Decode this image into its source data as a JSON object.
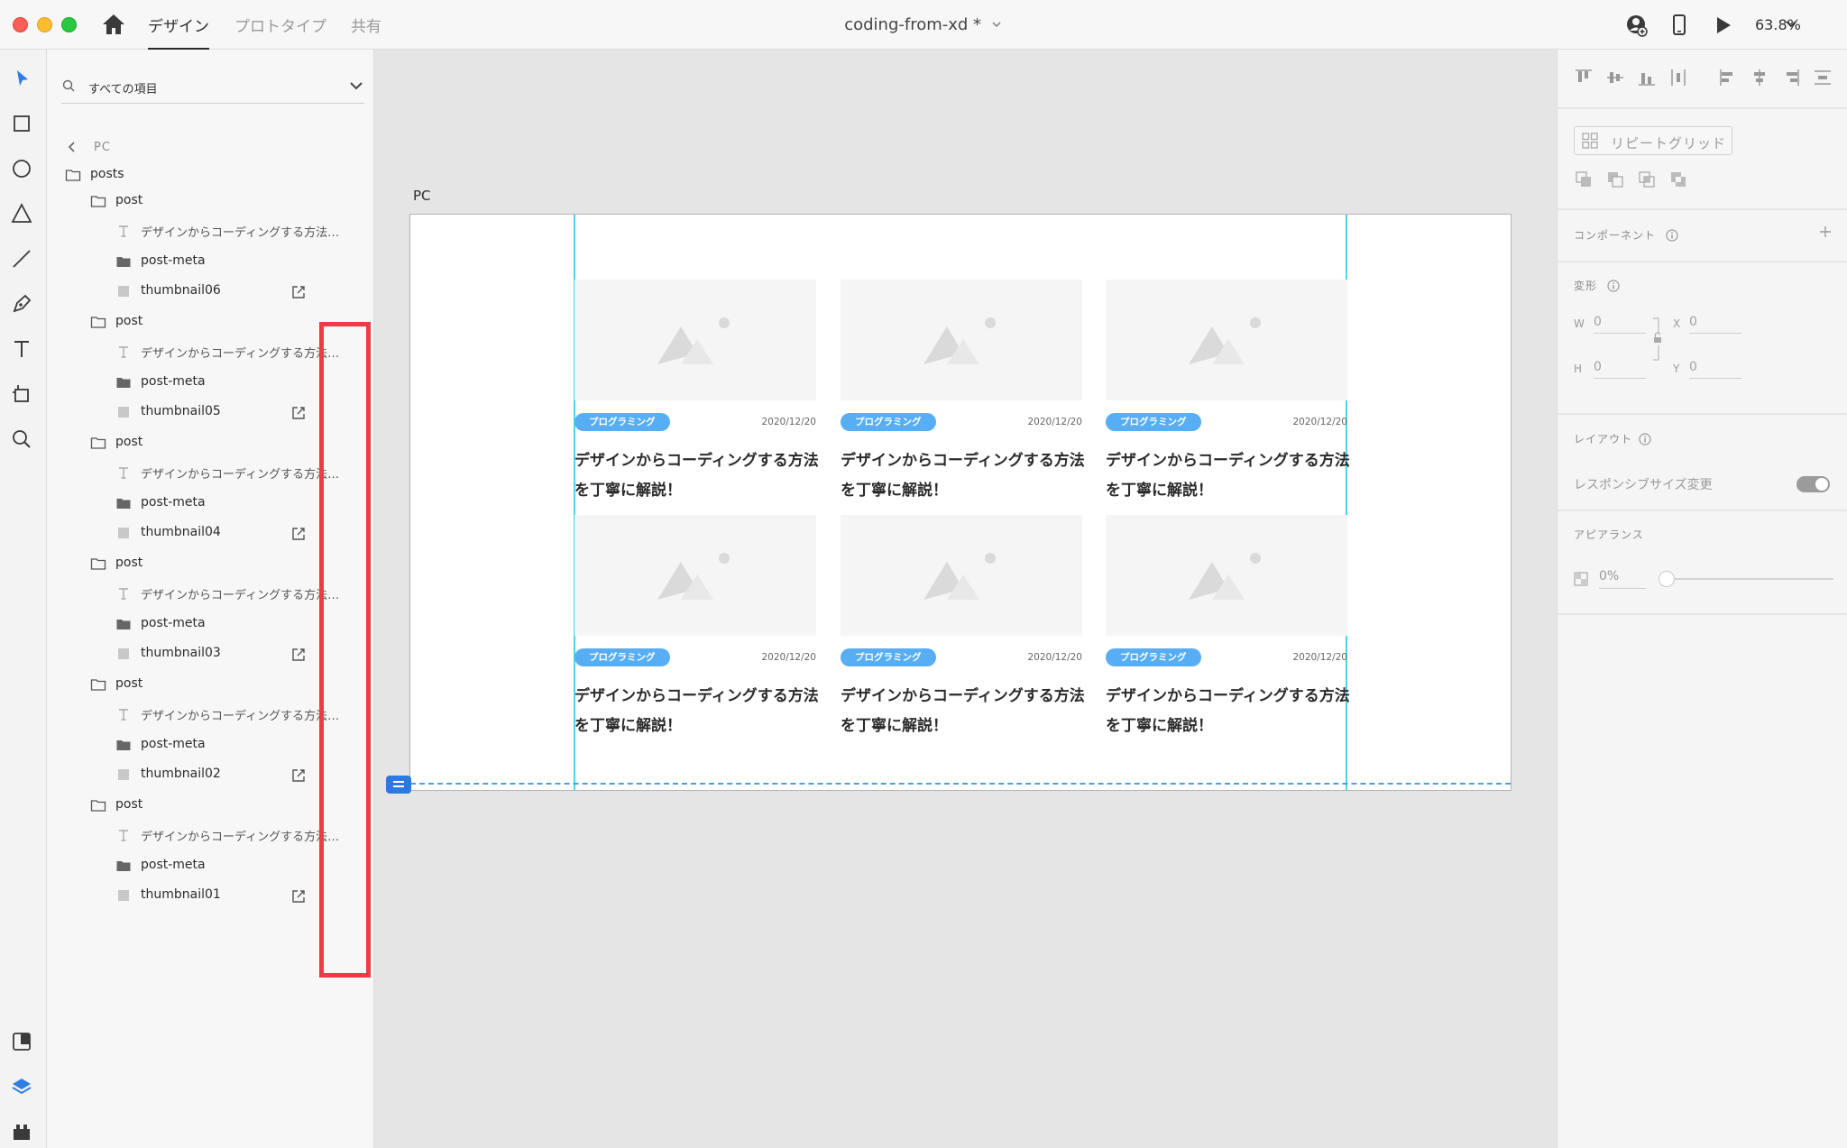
{
  "titlebar": {
    "modes": [
      "デザイン",
      "プロトタイプ",
      "共有"
    ],
    "active_mode": "デザイン",
    "document_title": "coding-from-xd *",
    "zoom": "63.8%"
  },
  "layers_panel": {
    "filter_label": "すべての項目",
    "breadcrumb": "PC",
    "root_group": "posts",
    "post_label": "post",
    "text_layer": "デザインからコーディングする方法…",
    "meta_layer": "post-meta",
    "thumbnails": [
      "thumbnail06",
      "thumbnail05",
      "thumbnail04",
      "thumbnail03",
      "thumbnail02",
      "thumbnail01"
    ],
    "highlight_color": "#ee3b46"
  },
  "artboard": {
    "name": "PC",
    "cards": [
      {
        "category": "プログラミング",
        "date": "2020/12/20",
        "title": "デザインからコーディングする方法を丁寧に解説！"
      },
      {
        "category": "プログラミング",
        "date": "2020/12/20",
        "title": "デザインからコーディングする方法を丁寧に解説！"
      },
      {
        "category": "プログラミング",
        "date": "2020/12/20",
        "title": "デザインからコーディングする方法を丁寧に解説！"
      },
      {
        "category": "プログラミング",
        "date": "2020/12/20",
        "title": "デザインからコーディングする方法を丁寧に解説！"
      },
      {
        "category": "プログラミング",
        "date": "2020/12/20",
        "title": "デザインからコーディングする方法を丁寧に解説！"
      },
      {
        "category": "プログラミング",
        "date": "2020/12/20",
        "title": "デザインからコーディングする方法を丁寧に解説！"
      }
    ],
    "category_color": "#57aef5",
    "guide_color": "#46d7e8"
  },
  "properties_panel": {
    "repeat_grid_label": "リピートグリッド",
    "component_title": "コンポーネント",
    "transform_title": "変形",
    "fields": {
      "w_label": "W",
      "w_value": "0",
      "x_label": "X",
      "x_value": "0",
      "h_label": "H",
      "h_value": "0",
      "y_label": "Y",
      "y_value": "0"
    },
    "layout_title": "レイアウト",
    "responsive_label": "レスポンシブサイズ変更",
    "appearance_title": "アピアランス",
    "opacity_value": "0%"
  }
}
